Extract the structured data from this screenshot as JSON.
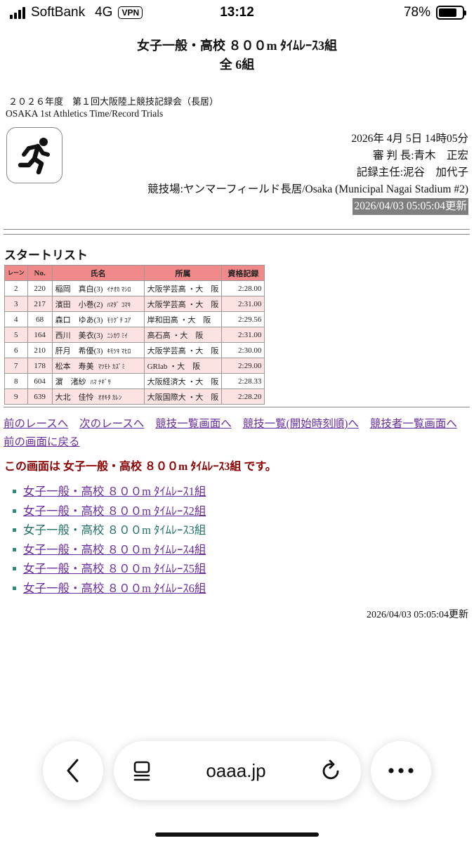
{
  "status_bar": {
    "carrier": "SoftBank",
    "network": "4G",
    "vpn": "VPN",
    "time": "13:12",
    "battery_percent": "78%",
    "battery_level": 0.78
  },
  "header": {
    "title_line1": "女子一般・高校 ８００m ﾀｲﾑﾚｰｽ3組",
    "title_line2": "全 6組",
    "meet_jp": "２０２６年度　第１回大阪陸上競技記録会（長居）",
    "meet_en": "OSAKA 1st Athletics Time/Record Trials"
  },
  "info": {
    "datetime": "2026年 4月 5日 14時05分",
    "referee": "審 判 長:青木　正宏",
    "recorder": "記録主任:泥谷　加代子",
    "venue": "競技場:ヤンマーフィールド長居/Osaka (Municipal Nagai Stadium #2)",
    "updated": "2026/04/03 05:05:04更新"
  },
  "start_list": {
    "heading": "スタートリスト",
    "columns": [
      "レーン",
      "No.",
      "氏名",
      "所属",
      "資格記録"
    ],
    "rows": [
      {
        "lane": "2",
        "no": "220",
        "name": "稲岡　真白(3)",
        "kana": "ｲﾅｵｶ ﾏｼﾛ",
        "team": "大阪学芸高 ・大　阪",
        "record": "2:28.00"
      },
      {
        "lane": "3",
        "no": "217",
        "name": "濱田　小巻(2)",
        "kana": "ﾊﾏﾀﾞ ｺﾏｷ",
        "team": "大阪学芸高 ・大　阪",
        "record": "2:31.00"
      },
      {
        "lane": "4",
        "no": "68",
        "name": "森口　ゆあ(3)",
        "kana": "ﾓﾘｸﾞﾁ ﾕｱ",
        "team": "岸和田高 ・大　阪",
        "record": "2:29.56"
      },
      {
        "lane": "5",
        "no": "164",
        "name": "西川　美衣(3)",
        "kana": "ﾆｼｶﾜ ﾐｲ",
        "team": "高石高 ・大　阪",
        "record": "2:31.00"
      },
      {
        "lane": "6",
        "no": "210",
        "name": "肝月　希優(3)",
        "kana": "ｷﾓﾂｷ ﾏﾋﾛ",
        "team": "大阪学芸高 ・大　阪",
        "record": "2:30.00"
      },
      {
        "lane": "7",
        "no": "178",
        "name": "松本　寿美",
        "kana": "ﾏﾂﾓﾄ ｶｽﾞﾐ",
        "team": "GRlab ・大　阪",
        "record": "2:29.00"
      },
      {
        "lane": "8",
        "no": "604",
        "name": "濵　渚紗",
        "kana": "ﾊﾏ ﾅｷﾞｻ",
        "team": "大阪経済大 ・大　阪",
        "record": "2:28.33"
      },
      {
        "lane": "9",
        "no": "639",
        "name": "大北　佳怜",
        "kana": "ｵｵｷﾀ ｶﾚﾝ",
        "team": "大阪国際大 ・大　阪",
        "record": "2:28.20"
      }
    ]
  },
  "nav": {
    "prev_race": "前のレースへ",
    "next_race": "次のレースへ",
    "event_list": "競技一覧画面へ",
    "event_list_time": "競技一覧(開始時刻順)へ",
    "athlete_list": "競技者一覧画面へ",
    "back": "前の画面に戻る"
  },
  "current_page_text": "この画面は 女子一般・高校 ８００m ﾀｲﾑﾚｰｽ3組 です。",
  "races": [
    {
      "label": "女子一般・高校 ８００m ﾀｲﾑﾚｰｽ1組",
      "current": false
    },
    {
      "label": "女子一般・高校 ８００m ﾀｲﾑﾚｰｽ2組",
      "current": false
    },
    {
      "label": "女子一般・高校 ８００m ﾀｲﾑﾚｰｽ3組",
      "current": true
    },
    {
      "label": "女子一般・高校 ８００m ﾀｲﾑﾚｰｽ4組",
      "current": false
    },
    {
      "label": "女子一般・高校 ８００m ﾀｲﾑﾚｰｽ5組",
      "current": false
    },
    {
      "label": "女子一般・高校 ８００m ﾀｲﾑﾚｰｽ6組",
      "current": false
    }
  ],
  "footer_updated": "2026/04/03 05:05:04更新",
  "browser": {
    "url": "oaaa.jp",
    "icons": [
      "back-chevron-icon",
      "reader-menu-icon",
      "reload-icon",
      "more-icon"
    ]
  },
  "colors": {
    "table_header": "#f08a8a",
    "table_row_alt": "#fde2e2",
    "link": "#6a2c9c",
    "notice": "#8b0000",
    "updated_bg": "#7f7f7f"
  }
}
